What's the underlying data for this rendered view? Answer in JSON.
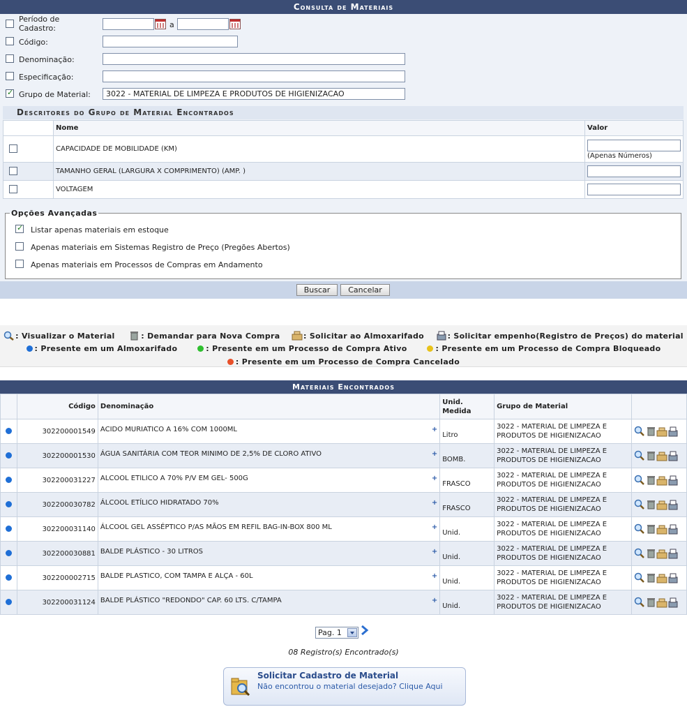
{
  "form": {
    "title": "Consulta de Materiais",
    "fields": {
      "periodo": {
        "label": "Período de Cadastro:",
        "checked": false,
        "from": "",
        "to": "",
        "separator": "a"
      },
      "codigo": {
        "label": "Código:",
        "checked": false,
        "value": ""
      },
      "denominacao": {
        "label": "Denominação:",
        "checked": false,
        "value": ""
      },
      "especificacao": {
        "label": "Especificação:",
        "checked": false,
        "value": ""
      },
      "grupo": {
        "label": "Grupo de Material:",
        "checked": true,
        "value": "3022 - MATERIAL DE LIMPEZA E PRODUTOS DE HIGIENIZACAO"
      }
    },
    "descritores": {
      "title": "Descritores do Grupo de Material Encontrados",
      "col_nome": "Nome",
      "col_valor": "Valor",
      "rows": [
        {
          "nome": "CAPACIDADE DE MOBILIDADE (KM)",
          "hint": "(Apenas Números)"
        },
        {
          "nome": "TAMANHO GERAL (LARGURA X COMPRIMENTO) (AMP. )",
          "hint": ""
        },
        {
          "nome": "VOLTAGEM",
          "hint": ""
        }
      ]
    },
    "opcoes": {
      "legend": "Opções Avançadas",
      "items": [
        {
          "label": "Listar apenas materiais em estoque",
          "checked": true
        },
        {
          "label": "Apenas materiais em Sistemas Registro de Preço (Pregões Abertos)",
          "checked": false
        },
        {
          "label": "Apenas materiais em Processos de Compras em Andamento",
          "checked": false
        }
      ]
    },
    "buttons": {
      "buscar": "Buscar",
      "cancelar": "Cancelar"
    }
  },
  "legend": {
    "visualizar": ": Visualizar o Material",
    "demandar": ": Demandar para Nova Compra",
    "solicitar_almox": ": Solicitar ao Almoxarifado",
    "solicitar_empenho": ": Solicitar empenho(Registro de Preços) do material",
    "almox": ": Presente em um Almoxarifado",
    "ativo": ": Presente em um Processo de Compra Ativo",
    "bloqueado": ": Presente em um Processo de Compra Bloqueado",
    "cancelado": ": Presente em um Processo de Compra Cancelado",
    "colors": {
      "almox": "#1f6fd6",
      "ativo": "#2fbf2f",
      "bloqueado": "#e8c21a",
      "cancelado": "#e8502a"
    }
  },
  "materiais": {
    "title": "Materiais Encontrados",
    "headers": {
      "codigo": "Código",
      "denominacao": "Denominação",
      "unid": "Unid. Medida",
      "grupo": "Grupo de Material"
    },
    "rows": [
      {
        "codigo": "302200001549",
        "denominacao": "ACIDO MURIATICO A 16% COM 1000ML",
        "unid": "Litro",
        "grupo": "3022 - MATERIAL DE LIMPEZA E PRODUTOS DE HIGIENIZACAO"
      },
      {
        "codigo": "302200001530",
        "denominacao": "ÁGUA SANITÁRIA COM TEOR MINIMO DE 2,5% DE CLORO ATIVO",
        "unid": "BOMB.",
        "grupo": "3022 - MATERIAL DE LIMPEZA E PRODUTOS DE HIGIENIZACAO"
      },
      {
        "codigo": "302200031227",
        "denominacao": "ALCOOL ETILICO A 70% P/V EM GEL- 500G",
        "unid": "FRASCO",
        "grupo": "3022 - MATERIAL DE LIMPEZA E PRODUTOS DE HIGIENIZACAO"
      },
      {
        "codigo": "302200030782",
        "denominacao": "ÁLCOOL ETÍLICO HIDRATADO 70%",
        "unid": "FRASCO",
        "grupo": "3022 - MATERIAL DE LIMPEZA E PRODUTOS DE HIGIENIZACAO"
      },
      {
        "codigo": "302200031140",
        "denominacao": "ÁLCOOL GEL ASSÉPTICO P/AS MÃOS EM REFIL BAG-IN-BOX 800 ML",
        "unid": "Unid.",
        "grupo": "3022 - MATERIAL DE LIMPEZA E PRODUTOS DE HIGIENIZACAO"
      },
      {
        "codigo": "302200030881",
        "denominacao": "BALDE PLÁSTICO - 30 LITROS",
        "unid": "Unid.",
        "grupo": "3022 - MATERIAL DE LIMPEZA E PRODUTOS DE HIGIENIZACAO"
      },
      {
        "codigo": "302200002715",
        "denominacao": "BALDE PLASTICO, COM TAMPA E ALÇA - 60L",
        "unid": "Unid.",
        "grupo": "3022 - MATERIAL DE LIMPEZA E PRODUTOS DE HIGIENIZACAO"
      },
      {
        "codigo": "302200031124",
        "denominacao": "BALDE PLÁSTICO \"REDONDO\" CAP. 60 LTS. C/TAMPA",
        "unid": "Unid.",
        "grupo": "3022 - MATERIAL DE LIMPEZA E PRODUTOS DE HIGIENIZACAO"
      }
    ],
    "plus": "+"
  },
  "pagination": {
    "page_label": "Pag. 1",
    "records": "08 Registro(s) Encontrado(s)"
  },
  "solicitar": {
    "title": "Solicitar Cadastro de Material",
    "subtitle": "Não encontrou o material desejado? Clique Aqui"
  }
}
